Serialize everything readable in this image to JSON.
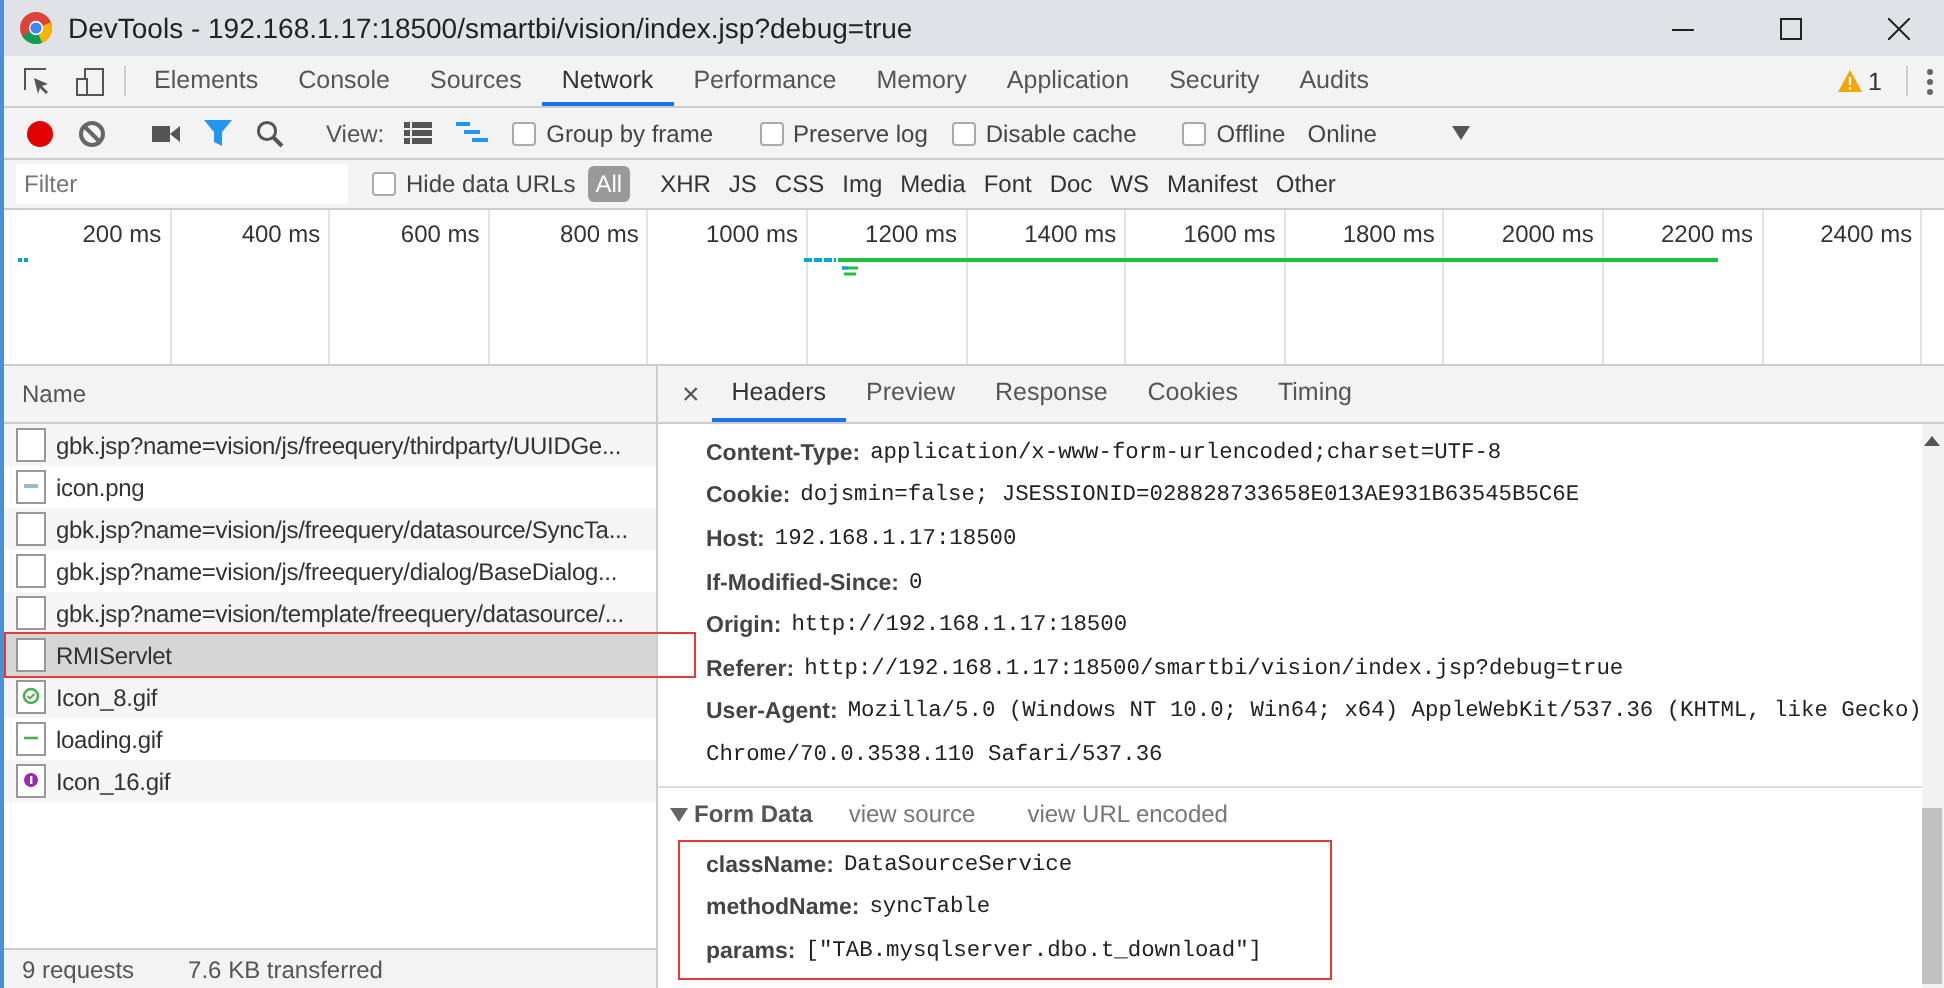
{
  "window": {
    "title": "DevTools - 192.168.1.17:18500/smartbi/vision/index.jsp?debug=true"
  },
  "main_tabs": [
    {
      "label": "Elements",
      "selected": false
    },
    {
      "label": "Console",
      "selected": false
    },
    {
      "label": "Sources",
      "selected": false
    },
    {
      "label": "Network",
      "selected": true
    },
    {
      "label": "Performance",
      "selected": false
    },
    {
      "label": "Memory",
      "selected": false
    },
    {
      "label": "Application",
      "selected": false
    },
    {
      "label": "Security",
      "selected": false
    },
    {
      "label": "Audits",
      "selected": false
    }
  ],
  "warning_count": "1",
  "toolbar": {
    "recording": true,
    "filter_on": true,
    "view_label": "View:",
    "options": [
      {
        "label": "Group by frame",
        "checked": false
      },
      {
        "label": "Preserve log",
        "checked": false
      },
      {
        "label": "Disable cache",
        "checked": false
      },
      {
        "label": "Offline",
        "checked": false
      }
    ],
    "throttle": "Online"
  },
  "filter": {
    "placeholder": "Filter",
    "hide_data_urls": {
      "label": "Hide data URLs",
      "checked": false
    },
    "types": [
      {
        "label": "All",
        "selected": true
      },
      {
        "label": "XHR",
        "selected": false
      },
      {
        "label": "JS",
        "selected": false
      },
      {
        "label": "CSS",
        "selected": false
      },
      {
        "label": "Img",
        "selected": false
      },
      {
        "label": "Media",
        "selected": false
      },
      {
        "label": "Font",
        "selected": false
      },
      {
        "label": "Doc",
        "selected": false
      },
      {
        "label": "WS",
        "selected": false
      },
      {
        "label": "Manifest",
        "selected": false
      },
      {
        "label": "Other",
        "selected": false
      }
    ]
  },
  "timeline": {
    "ticks": [
      "200 ms",
      "400 ms",
      "600 ms",
      "800 ms",
      "1000 ms",
      "1200 ms",
      "1400 ms",
      "1600 ms",
      "1800 ms",
      "2000 ms",
      "2200 ms",
      "2400 ms"
    ]
  },
  "requests": {
    "column": "Name",
    "items": [
      {
        "name": "gbk.jsp?name=vision/js/freequery/thirdparty/UUIDGe...",
        "kind": "doc",
        "selected": false,
        "highlighted": false
      },
      {
        "name": "icon.png",
        "kind": "image",
        "selected": false,
        "highlighted": false
      },
      {
        "name": "gbk.jsp?name=vision/js/freequery/datasource/SyncTa...",
        "kind": "doc",
        "selected": false,
        "highlighted": false
      },
      {
        "name": "gbk.jsp?name=vision/js/freequery/dialog/BaseDialog...",
        "kind": "doc",
        "selected": false,
        "highlighted": false
      },
      {
        "name": "gbk.jsp?name=vision/template/freequery/datasource/...",
        "kind": "doc",
        "selected": false,
        "highlighted": false
      },
      {
        "name": "RMIServlet",
        "kind": "doc",
        "selected": true,
        "highlighted": true
      },
      {
        "name": "Icon_8.gif",
        "kind": "check",
        "selected": false,
        "highlighted": false
      },
      {
        "name": "loading.gif",
        "kind": "line",
        "selected": false,
        "highlighted": false
      },
      {
        "name": "Icon_16.gif",
        "kind": "info",
        "selected": false,
        "highlighted": false
      }
    ]
  },
  "detail": {
    "close": "×",
    "tabs": [
      {
        "label": "Headers",
        "selected": true
      },
      {
        "label": "Preview",
        "selected": false
      },
      {
        "label": "Response",
        "selected": false
      },
      {
        "label": "Cookies",
        "selected": false
      },
      {
        "label": "Timing",
        "selected": false
      }
    ],
    "headers": [
      {
        "name": "Content-Type:",
        "value": "application/x-www-form-urlencoded;charset=UTF-8"
      },
      {
        "name": "Cookie:",
        "value": "dojsmin=false; JSESSIONID=028828733658E013AE931B63545B5C6E"
      },
      {
        "name": "Host:",
        "value": "192.168.1.17:18500"
      },
      {
        "name": "If-Modified-Since:",
        "value": "0"
      },
      {
        "name": "Origin:",
        "value": "http://192.168.1.17:18500"
      },
      {
        "name": "Referer:",
        "value": "http://192.168.1.17:18500/smartbi/vision/index.jsp?debug=true"
      },
      {
        "name": "User-Agent:",
        "value": "Mozilla/5.0 (Windows NT 10.0; Win64; x64) AppleWebKit/537.36 (KHTML, like Gecko)",
        "continuation": "Chrome/70.0.3538.110 Safari/537.36"
      }
    ],
    "form_data": {
      "title": "Form Data",
      "expanded": true,
      "highlighted": true,
      "links": [
        "view source",
        "view URL encoded"
      ],
      "params": [
        {
          "name": "className:",
          "value": "DataSourceService"
        },
        {
          "name": "methodName:",
          "value": "syncTable"
        },
        {
          "name": "params:",
          "value": "[\"TAB.mysqlserver.dbo.t_download\"]"
        }
      ]
    }
  },
  "status": {
    "requests": "9 requests",
    "transferred": "7.6 KB transferred"
  }
}
